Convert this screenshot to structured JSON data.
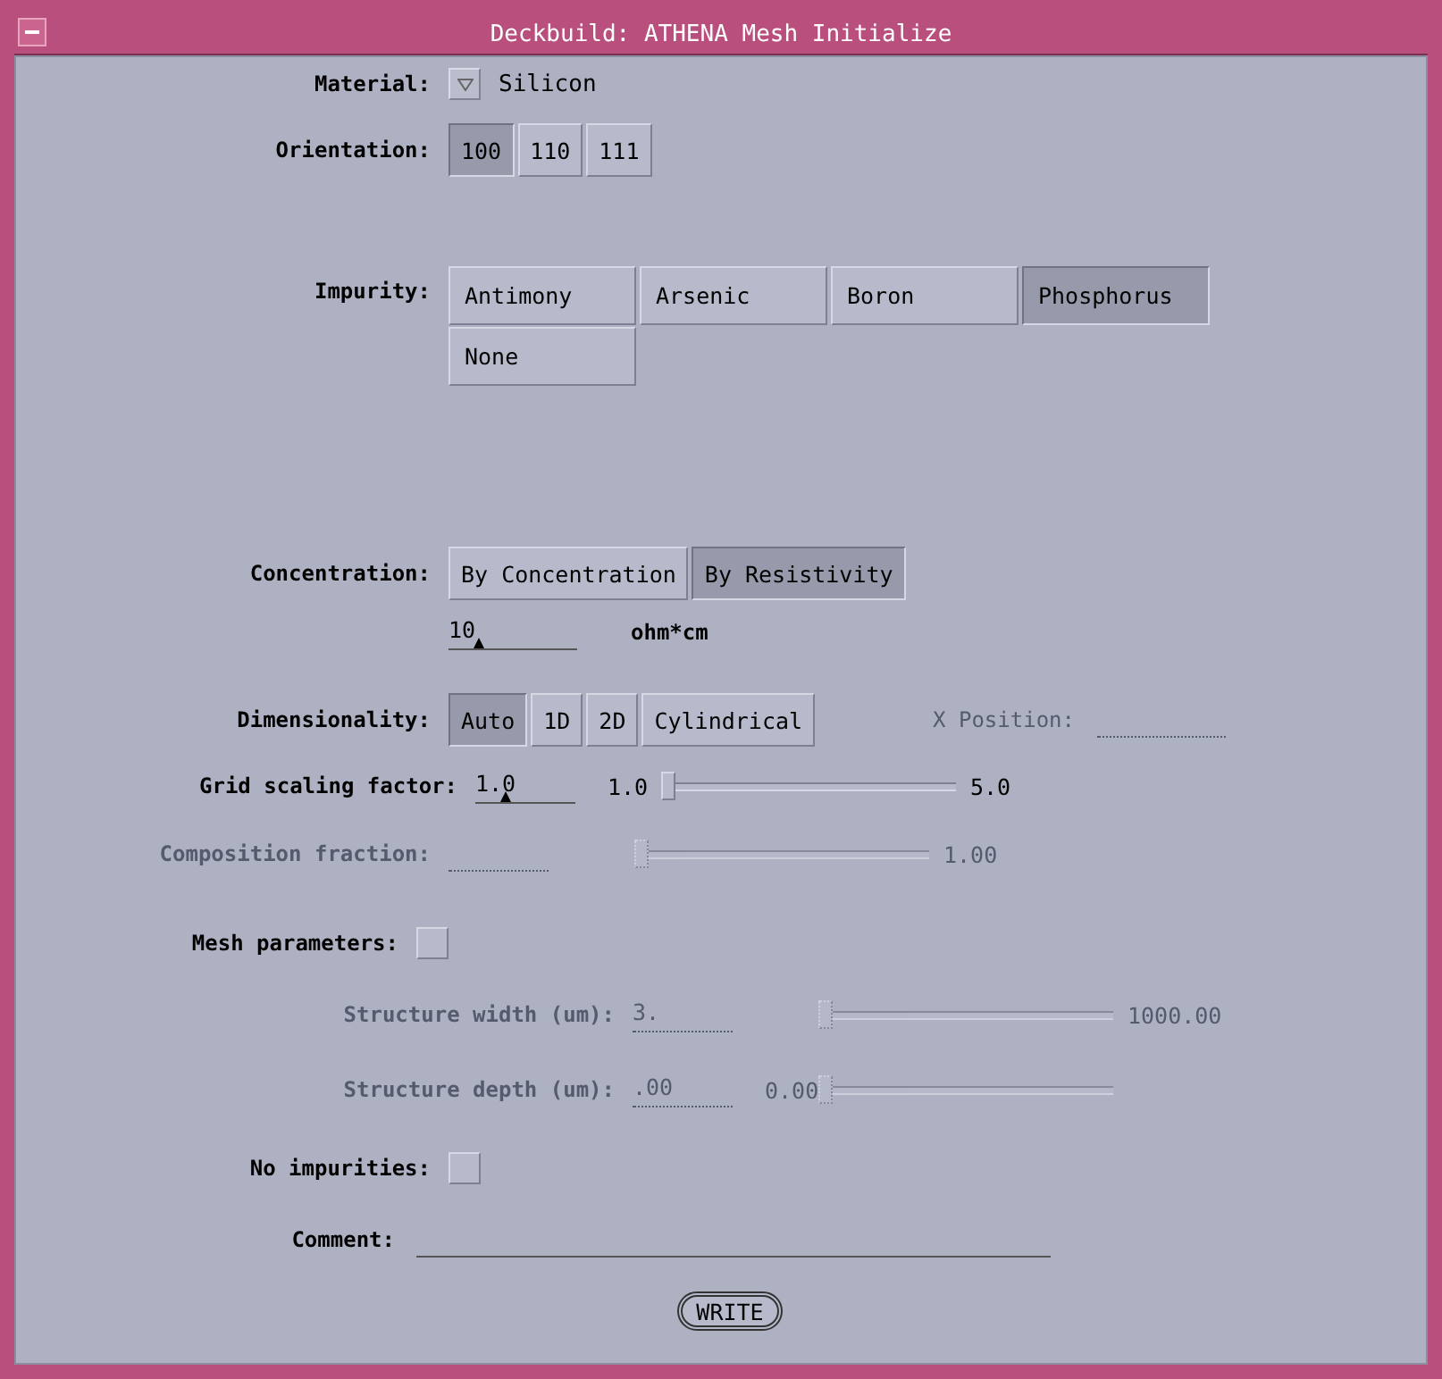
{
  "window": {
    "title": "Deckbuild: ATHENA Mesh Initialize"
  },
  "material": {
    "label": "Material:",
    "value": "Silicon"
  },
  "orientation": {
    "label": "Orientation:",
    "options": [
      {
        "label": "100",
        "selected": true
      },
      {
        "label": "110",
        "selected": false
      },
      {
        "label": "111",
        "selected": false
      }
    ]
  },
  "impurity": {
    "label": "Impurity:",
    "options": [
      {
        "label": "Antimony",
        "selected": false
      },
      {
        "label": "Arsenic",
        "selected": false
      },
      {
        "label": "Boron",
        "selected": false
      },
      {
        "label": "Phosphorus",
        "selected": true
      },
      {
        "label": "None",
        "selected": false
      }
    ]
  },
  "concentration": {
    "label": "Concentration:",
    "options": [
      {
        "label": "By Concentration",
        "selected": false
      },
      {
        "label": "By Resistivity",
        "selected": true
      }
    ]
  },
  "resistivity": {
    "value": "10",
    "unit": "ohm*cm"
  },
  "dimensionality": {
    "label": "Dimensionality:",
    "options": [
      {
        "label": "Auto",
        "selected": true
      },
      {
        "label": "1D",
        "selected": false
      },
      {
        "label": "2D",
        "selected": false
      },
      {
        "label": "Cylindrical",
        "selected": false
      }
    ],
    "x_position": {
      "label": "X Position:",
      "disabled": true
    }
  },
  "sliders": [
    {
      "label": "Grid scaling factor:",
      "value": "1.0",
      "min": "1.0",
      "max": "5.0",
      "level": 0,
      "disabled": false
    },
    {
      "label": "Composition fraction:",
      "max": "1.00",
      "level": 0,
      "disabled": true
    }
  ],
  "mesh_parameters": {
    "label": "Mesh parameters:",
    "checked": false
  },
  "mesh_sliders": [
    {
      "label": "Structure width (um):",
      "value": "3.",
      "max": "1000.00",
      "level": 0,
      "disabled": true
    },
    {
      "label": "Structure depth (um):",
      "value": ".00",
      "min": "0.00",
      "level": 0,
      "disabled": true
    }
  ],
  "no_impurities": {
    "label": "No impurities:",
    "checked": false
  },
  "comment": {
    "label": "Comment:"
  },
  "write_button": "WRITE"
}
